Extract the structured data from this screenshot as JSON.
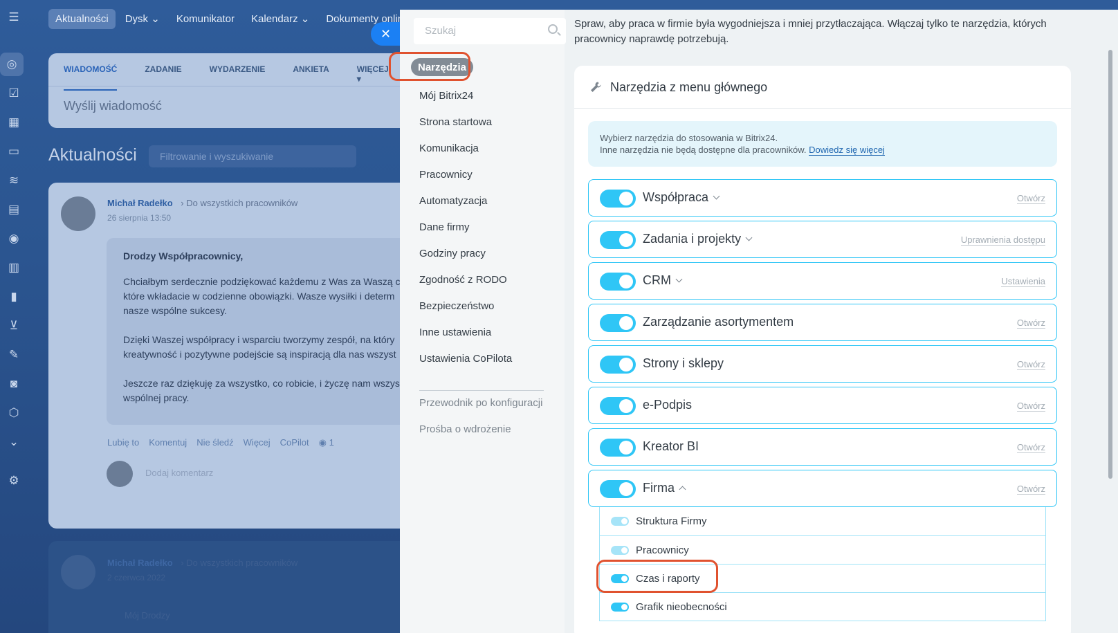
{
  "background": {
    "top_nav": [
      "Aktualności",
      "Dysk",
      "Komunikator",
      "Kalendarz",
      "Dokumenty online"
    ],
    "compose_tabs": [
      "WIADOMOŚĆ",
      "ZADANIE",
      "WYDARZENIE",
      "ANKIETA",
      "WIĘCEJ"
    ],
    "compose_placeholder": "Wyślij wiadomość",
    "feed_title": "Aktualności",
    "feed_filter_placeholder": "Filtrowanie i wyszukiwanie",
    "post": {
      "author": "Michał Radełko",
      "audience": "Do wszystkich pracowników",
      "date": "26 sierpnia 13:50",
      "greeting": "Drodzy Współpracownicy,",
      "paragraph1": "Chciałbym serdecznie podziękować każdemu z Was za Waszą c\nktóre wkładacie w codzienne obowiązki. Wasze wysiłki i determ\nnasze wspólne sukcesy.",
      "paragraph2": "Dzięki Waszej współpracy i wsparciu tworzymy zespół, na który\nkreatywność i pozytywne podejście są inspiracją dla nas wszyst",
      "paragraph3": "Jeszcze raz dziękuję za wszystko, co robicie, i życzę nam wszyst\nwspólnej pracy.",
      "actions": [
        "Lubię to",
        "Komentuj",
        "Nie śledź",
        "Więcej",
        "CoPilot",
        "1"
      ],
      "comment_placeholder": "Dodaj komentarz"
    },
    "post2": {
      "author": "Michał Radełko",
      "audience": "Do wszystkich pracowników",
      "date": "2 czerwca 2022",
      "snippet": "Mój Drodzy"
    }
  },
  "settings_nav": {
    "search_placeholder": "Szukaj",
    "active": "Narzędzia",
    "items": [
      "Mój Bitrix24",
      "Strona startowa",
      "Komunikacja",
      "Pracownicy",
      "Automatyzacja",
      "Dane firmy",
      "Godziny pracy",
      "Zgodność z RODO",
      "Bezpieczeństwo",
      "Inne ustawienia",
      "Ustawienia CoPilota"
    ],
    "extra_items": [
      "Przewodnik po konfiguracji",
      "Prośba o wdrożenie"
    ]
  },
  "content": {
    "intro": "Spraw, aby praca w firmie była wygodniejsza i mniej przytłaczająca. Włączaj tylko te narzędzia, których pracownicy naprawdę potrzebują.",
    "card_title": "Narzędzia z menu głównego",
    "info_line1": "Wybierz narzędzia do stosowania w Bitrix24.",
    "info_line2": "Inne narzędzia nie będą dostępne dla pracowników.",
    "info_link": "Dowiedz się więcej",
    "tools": [
      {
        "name": "Współpraca",
        "link": "Otwórz",
        "enabled": true
      },
      {
        "name": "Zadania i projekty",
        "link": "Uprawnienia dostępu",
        "enabled": true
      },
      {
        "name": "CRM",
        "link": "Ustawienia",
        "enabled": true
      },
      {
        "name": "Zarządzanie asortymentem",
        "link": "Otwórz",
        "enabled": true
      },
      {
        "name": "Strony i sklepy",
        "link": "Otwórz",
        "enabled": true
      },
      {
        "name": "e-Podpis",
        "link": "Otwórz",
        "enabled": true
      },
      {
        "name": "Kreator BI",
        "link": "Otwórz",
        "enabled": true
      },
      {
        "name": "Firma",
        "link": "Otwórz",
        "enabled": true
      }
    ],
    "firma_subtools": [
      {
        "name": "Struktura Firmy",
        "enabled": true
      },
      {
        "name": "Pracownicy",
        "enabled": true
      },
      {
        "name": "Czas i raporty",
        "enabled": true
      },
      {
        "name": "Grafik nieobecności",
        "enabled": true
      }
    ]
  },
  "colors": {
    "toggle_on": "#2fc6f6",
    "highlight": "#e0522f",
    "link": "#2067b0"
  }
}
